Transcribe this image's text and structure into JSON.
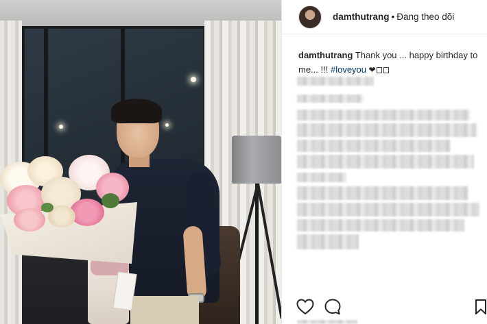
{
  "post": {
    "username": "damthutrang",
    "separator": "•",
    "follow_state": "Đang theo dõi"
  },
  "caption": {
    "username": "damthutrang",
    "text_before_hashtag": " Thank you ... happy birthday to me... !!! ",
    "hashtag": "#loveyou",
    "emoji": "❤"
  },
  "actions": {
    "like_icon": "heart-outline-icon",
    "comment_icon": "comment-bubble-icon",
    "save_icon": "bookmark-outline-icon"
  },
  "colors": {
    "text": "#262626",
    "hashtag": "#003569",
    "border": "#efefef"
  }
}
